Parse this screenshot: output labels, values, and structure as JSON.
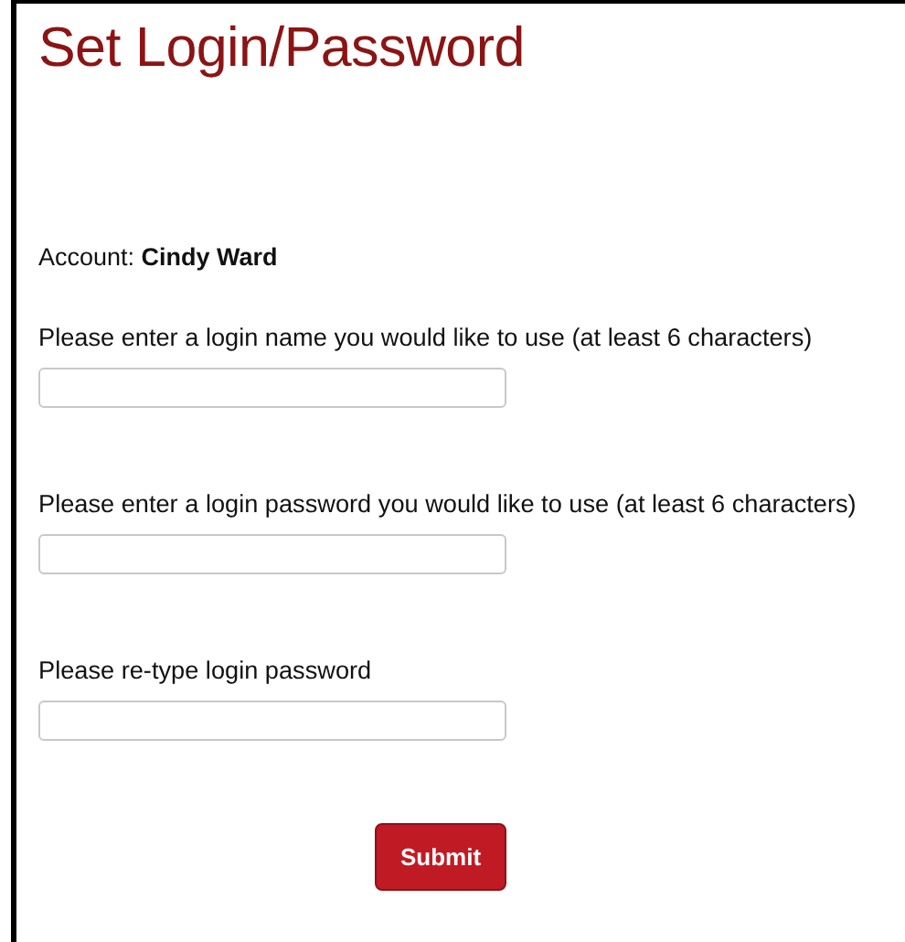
{
  "title": "Set Login/Password",
  "account": "Account: **Cindy Ward**",
  "fields": [
    {
      "label": "Please enter a login name you would like to use (at least 6 characters)"
    },
    {
      "label": "Please enter a login password you would like to use (at least 6 characters)"
    },
    {
      "label": "Please re-type login password"
    }
  ],
  "submit": "Submit"
}
